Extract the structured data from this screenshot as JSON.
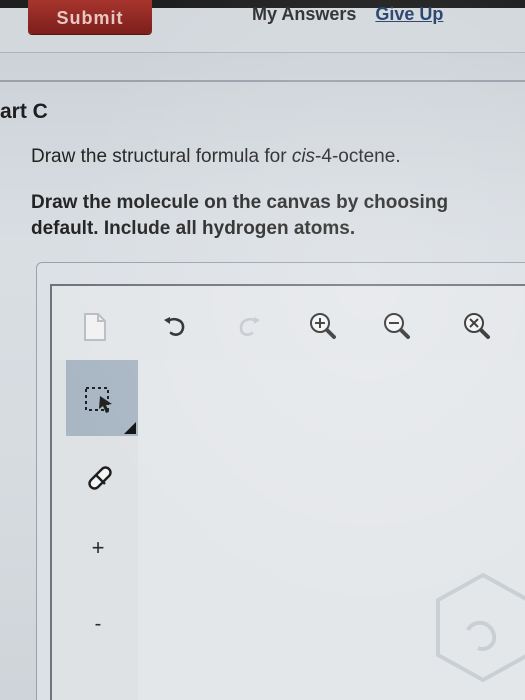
{
  "header": {
    "submit_label": "Submit",
    "my_answers_label": "My Answers",
    "give_up_label": "Give Up"
  },
  "question": {
    "part_title": "art C",
    "prompt_prefix": "Draw the structural formula for ",
    "prompt_compound": "cis",
    "prompt_suffix": "-4-octene.",
    "instructions": "Draw the molecule on the canvas by choosing\ndefault. Include all hydrogen atoms."
  },
  "toolbar": {
    "icons": [
      "new-document-icon",
      "undo-icon",
      "redo-icon",
      "zoom-in-icon",
      "zoom-out-icon",
      "zoom-reset-icon"
    ]
  },
  "sidebar": {
    "icons": [
      "selection-tool-icon",
      "eraser-icon",
      "increase-charge-icon",
      "decrease-charge-icon"
    ],
    "charge_plus": "+",
    "charge_minus": "-"
  },
  "colors": {
    "submit_bg": "#8f2a25",
    "selected_tool_bg": "#a9b6c4",
    "link": "#24416b"
  }
}
